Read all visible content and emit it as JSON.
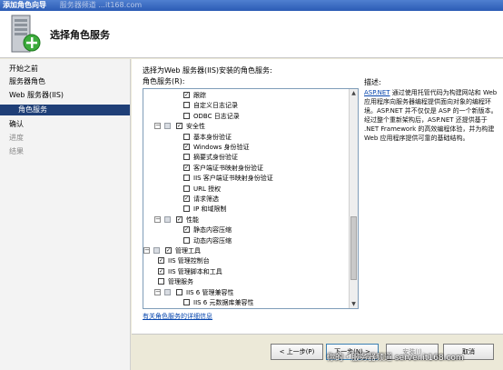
{
  "window": {
    "title": "添加角色向导",
    "title_overlay": "服务器频道 ...it168.com"
  },
  "header": {
    "title": "选择角色服务"
  },
  "nav": {
    "items": [
      {
        "label": "开始之前",
        "state": "normal"
      },
      {
        "label": "服务器角色",
        "state": "normal"
      },
      {
        "label": "Web 服务器(IIS)",
        "state": "normal"
      },
      {
        "label": "角色服务",
        "state": "current"
      },
      {
        "label": "确认",
        "state": "normal"
      },
      {
        "label": "进度",
        "state": "disabled"
      },
      {
        "label": "结果",
        "state": "disabled"
      }
    ]
  },
  "main": {
    "prompt": "选择为Web 服务器(IIS)安装的角色服务:",
    "roles_label": "角色服务(R):",
    "details_link": "有关角色服务的详细信息",
    "tree": [
      {
        "label": "跟踪",
        "level": 2,
        "checked": true
      },
      {
        "label": "自定义日志记录",
        "level": 2,
        "checked": false
      },
      {
        "label": "ODBC 日志记录",
        "level": 2,
        "checked": false
      },
      {
        "label": "安全性",
        "level": 1,
        "checked": true,
        "expander": "−"
      },
      {
        "label": "基本身份验证",
        "level": 2,
        "checked": false
      },
      {
        "label": "Windows 身份验证",
        "level": 2,
        "checked": true
      },
      {
        "label": "摘要式身份验证",
        "level": 2,
        "checked": false
      },
      {
        "label": "客户端证书映射身份验证",
        "level": 2,
        "checked": true
      },
      {
        "label": "IIS 客户端证书映射身份验证",
        "level": 2,
        "checked": false
      },
      {
        "label": "URL 授权",
        "level": 2,
        "checked": false
      },
      {
        "label": "请求筛选",
        "level": 2,
        "checked": true
      },
      {
        "label": "IP 和域限制",
        "level": 2,
        "checked": false
      },
      {
        "label": "性能",
        "level": 1,
        "checked": true,
        "expander": "−"
      },
      {
        "label": "静态内容压缩",
        "level": 2,
        "checked": true
      },
      {
        "label": "动态内容压缩",
        "level": 2,
        "checked": false
      },
      {
        "label": "管理工具",
        "level": 0,
        "checked": true,
        "expander": "−"
      },
      {
        "label": "IIS 管理控制台",
        "level": 1,
        "checked": true
      },
      {
        "label": "IIS 管理脚本和工具",
        "level": 1,
        "checked": true
      },
      {
        "label": "管理服务",
        "level": 1,
        "checked": false
      },
      {
        "label": "IIS 6 管理兼容性",
        "level": 1,
        "checked": false,
        "expander": "−"
      },
      {
        "label": "IIS 6 元数据库兼容性",
        "level": 2,
        "checked": false
      }
    ]
  },
  "description": {
    "title": "描述:",
    "link": "ASP.NET",
    "text": " 通过使用托管代码为构建网站和 Web 应用程序向服务器编程提供面向对象的编程环境。ASP.NET 并不仅仅是 ASP 的一个新版本。经过整个重新架构后，ASP.NET 还提供基于 .NET Framework 的高效编程体验，并为构建 Web 应用程序提供可靠的基础结构。"
  },
  "footer": {
    "prev": "< 上一步(P)",
    "next": "下一步(N) >",
    "install": "安装(I)",
    "cancel": "取消"
  },
  "watermark": "你的・服务器频道 server.it168.com"
}
